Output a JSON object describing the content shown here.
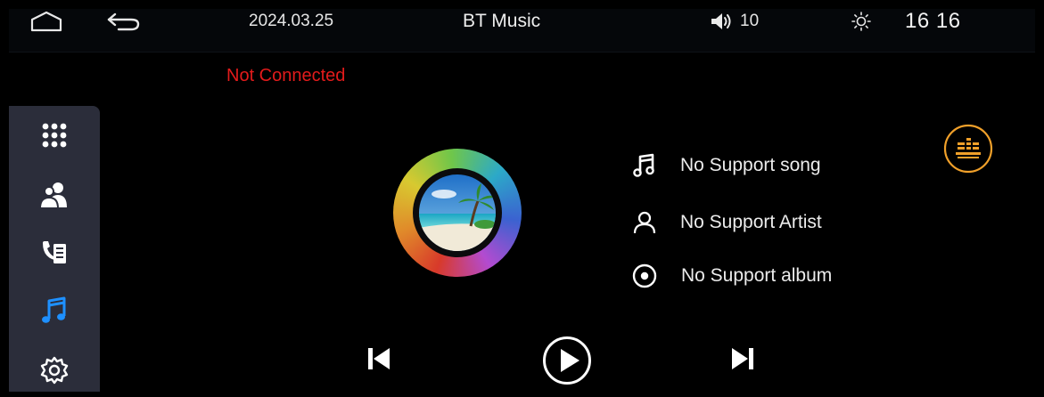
{
  "statusbar": {
    "date": "2024.03.25",
    "title": "BT Music",
    "volume": "10",
    "clock": "16 16",
    "icons": [
      "home-icon",
      "back-icon",
      "volume-icon",
      "brightness-icon"
    ]
  },
  "connection": {
    "status": "Not Connected",
    "color": "#e31b1b"
  },
  "sidebar": {
    "items": [
      {
        "icon": "apps-grid-icon",
        "active": false
      },
      {
        "icon": "contacts-icon",
        "active": false
      },
      {
        "icon": "call-log-icon",
        "active": false
      },
      {
        "icon": "music-note-icon",
        "active": true
      },
      {
        "icon": "settings-gear-icon",
        "active": false
      }
    ],
    "active_color": "#1e90ff"
  },
  "track": {
    "song": "No Support song",
    "artist": "No Support Artist",
    "album": "No Support album"
  },
  "controls": [
    "previous-icon",
    "play-icon",
    "next-icon"
  ],
  "colors": {
    "accent_orange": "#f0a02a"
  }
}
